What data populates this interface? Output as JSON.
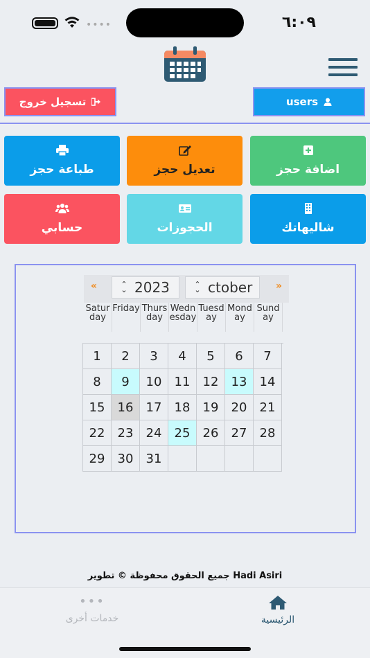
{
  "status": {
    "time": "٦:٠٩",
    "signal_dots": "••••"
  },
  "header": {
    "logout_label": "تسجيل خروج",
    "users_label": "users"
  },
  "tiles": {
    "print": "طباعة حجز",
    "edit": "تعديل حجز",
    "add": "اضافة حجز",
    "account": "حسابي",
    "bookings": "الحجوزات",
    "chalets": "شاليهاتك"
  },
  "calendar": {
    "prev_label": "«",
    "next_label": "»",
    "year": "2023",
    "month": "ctober",
    "weekdays": [
      "Saturday",
      "Friday",
      "Thursday",
      "Wednesday",
      "Tuesday",
      "Monday",
      "Sunday"
    ],
    "days": [
      "1",
      "2",
      "3",
      "4",
      "5",
      "6",
      "7",
      "8",
      "9",
      "10",
      "11",
      "12",
      "13",
      "14",
      "15",
      "16",
      "17",
      "18",
      "19",
      "20",
      "21",
      "22",
      "23",
      "24",
      "25",
      "26",
      "27",
      "28",
      "29",
      "30",
      "31"
    ],
    "booked_days": [
      "9",
      "13",
      "25"
    ],
    "today": "16"
  },
  "footer": {
    "copyright": "جميع الحقوق محفوظة © تطوير Hadi Asiri",
    "tab_home": "الرئيسية",
    "tab_more": "خدمات أخرى",
    "more_dots": "•••"
  },
  "colors": {
    "accent": "#2e5a73",
    "blue": "#0b9de9",
    "red": "#fb5360",
    "orange": "#fd8d0c",
    "green": "#4ec77d",
    "cyan": "#63d7e6",
    "booked": "#c8fbfd",
    "border": "#8a92f0"
  }
}
